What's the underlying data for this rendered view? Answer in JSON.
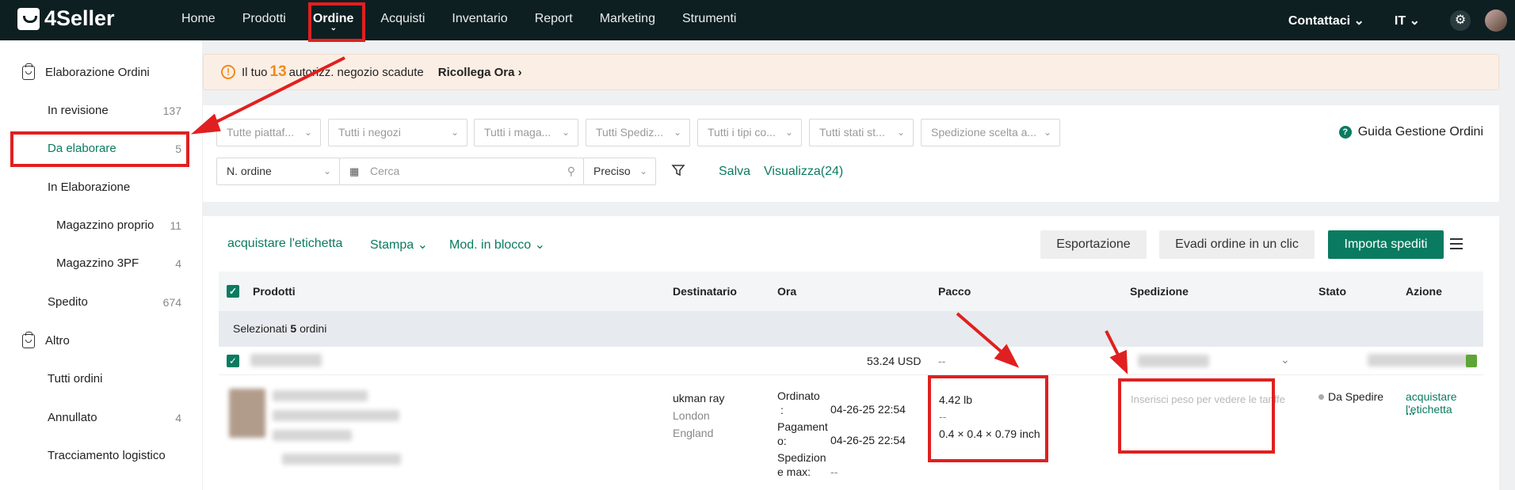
{
  "app": {
    "logo": "4Seller"
  },
  "nav": {
    "items": [
      "Home",
      "Prodotti",
      "Ordine",
      "Acquisti",
      "Inventario",
      "Report",
      "Marketing",
      "Strumenti"
    ],
    "active": "Ordine",
    "contact": "Contattaci",
    "lang": "IT"
  },
  "sidebar": {
    "section1": "Elaborazione Ordini",
    "items": [
      {
        "label": "In revisione",
        "count": "137"
      },
      {
        "label": "Da elaborare",
        "count": "5"
      },
      {
        "label": "In Elaborazione",
        "count": ""
      },
      {
        "label": "Magazzino proprio",
        "count": "11"
      },
      {
        "label": "Magazzino 3PF",
        "count": "4"
      },
      {
        "label": "Spedito",
        "count": "674"
      }
    ],
    "section2": "Altro",
    "items2": [
      {
        "label": "Tutti ordini",
        "count": ""
      },
      {
        "label": "Annullato",
        "count": "4"
      },
      {
        "label": "Tracciamento logistico",
        "count": ""
      }
    ]
  },
  "banner": {
    "prefix": "Il tuo",
    "count": "13",
    "suffix": "autorizz. negozio scadute",
    "link": "Ricollega Ora"
  },
  "filters": {
    "dropdowns": [
      "Tutte piattaf...",
      "Tutti i negozi",
      "Tutti i maga...",
      "Tutti Spediz...",
      "Tutti i tipi co...",
      "Tutti stati st...",
      "Spedizione scelta a..."
    ],
    "search_type": "N. ordine",
    "search_placeholder": "Cerca",
    "match_mode": "Preciso",
    "save": "Salva",
    "view": "Visualizza(24)",
    "guide": "Guida Gestione Ordini"
  },
  "toolbar": {
    "buy_label": "acquistare l'etichetta",
    "print": "Stampa",
    "bulk": "Mod. in blocco",
    "export": "Esportazione",
    "one_click": "Evadi ordine in un clic",
    "import": "Importa spediti"
  },
  "table": {
    "headers": [
      "Prodotti",
      "Destinatario",
      "Ora",
      "Pacco",
      "Spedizione",
      "Stato",
      "Azione"
    ],
    "selected_prefix": "Selezionati",
    "selected_count": "5",
    "selected_suffix": "ordini",
    "order": {
      "amount": "53.24 USD",
      "package_summary": "--",
      "recipient_name": "ukman ray",
      "recipient_city": "London",
      "recipient_region": "England",
      "time_ordered_label": "Ordinato",
      "time_ordered_colon": ":",
      "time_ordered": "04-26-25 22:54",
      "time_paid_label_1": "Pagament",
      "time_paid_label_2": "o:",
      "time_paid": "04-26-25 22:54",
      "time_ship_label_1": "Spedizion",
      "time_ship_label_2": "e max:",
      "time_ship": "--",
      "weight": "4.42 lb",
      "weight_sub": "--",
      "dimensions": "0.4 × 0.4 × 0.79 inch",
      "shipping_placeholder": "Inserisci peso per vedere le tariffe",
      "status": "Da Spedire",
      "action": "acquistare l'etichetta",
      "more": "..."
    }
  },
  "colors": {
    "accent": "#0a7b60",
    "topbar": "#0e1f22",
    "warning": "#f08a1c",
    "annotation": "#e02020"
  }
}
